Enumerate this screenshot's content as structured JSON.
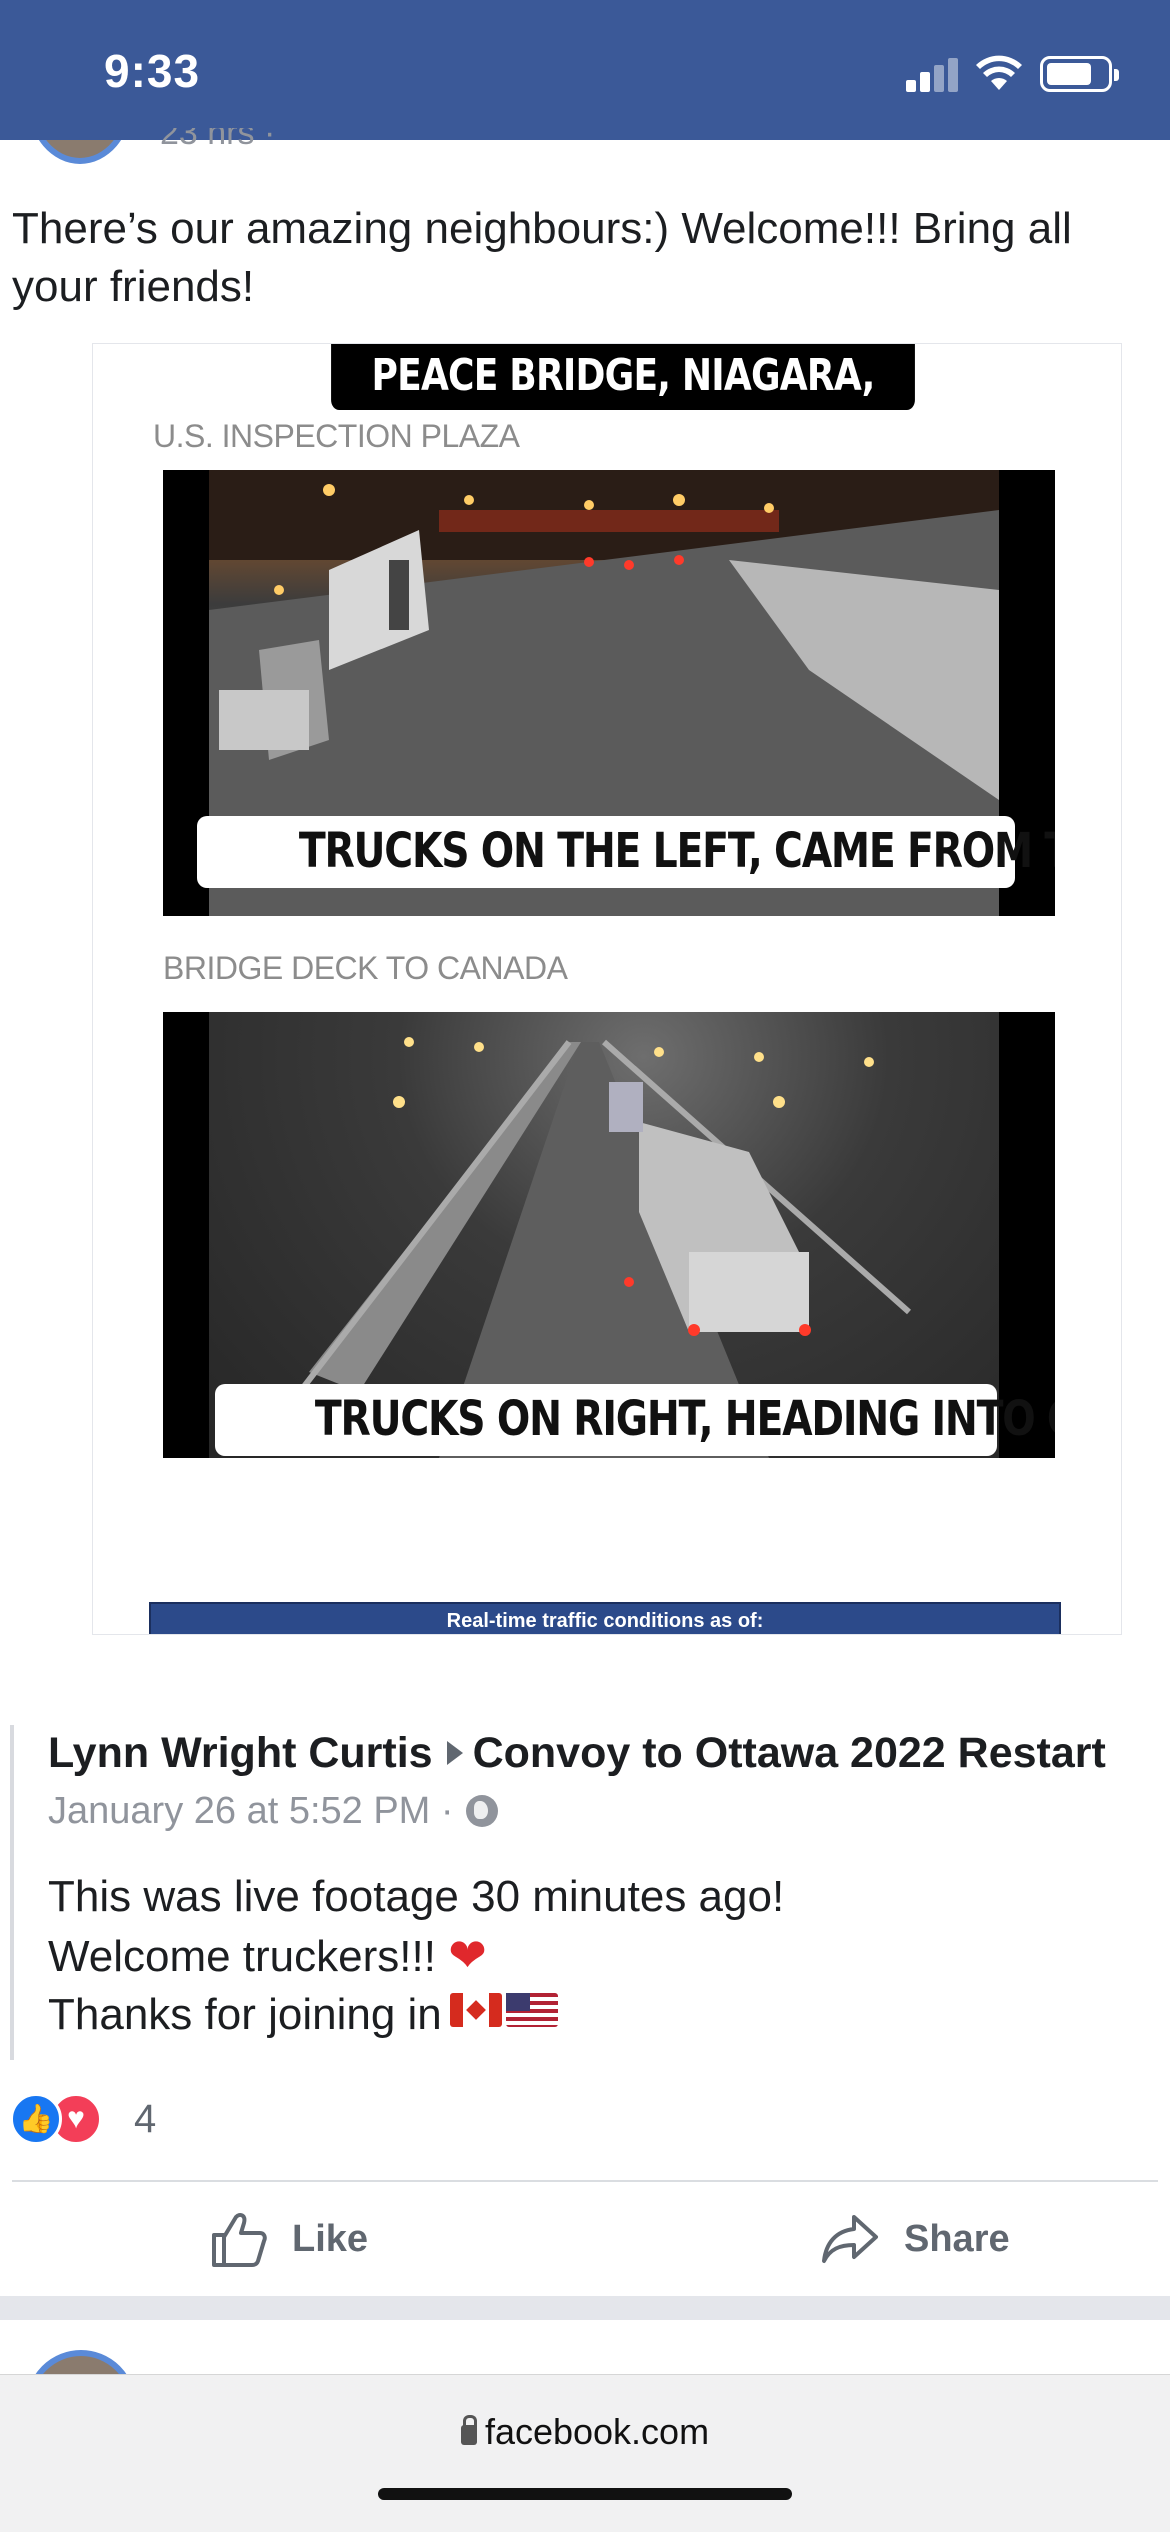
{
  "status_bar": {
    "time": "9:33"
  },
  "post": {
    "text": "There’s our amazing neighbours:) Welcome!!! Bring all your friends!"
  },
  "shared_image": {
    "title": "PEACE BRIDGE, NIAGARA, BUFFALO NY",
    "label_1": "U.S. INSPECTION PLAZA",
    "caption_1": "TRUCKS ON THE LEFT, CAME FROM THE USA",
    "label_2": "BRIDGE DECK TO CANADA",
    "caption_2": "TRUCKS ON RIGHT, HEADING INTO CANADA",
    "banner": "Real-time traffic conditions as of:"
  },
  "shared_post": {
    "author": "Lynn Wright Curtis",
    "group": "Convoy to Ottawa 2022 Restart",
    "time": "January 26 at 5:52 PM ·",
    "line_1": "This was live footage 30 minutes ago!",
    "line_2": "Welcome truckers!!!",
    "line_3": "Thanks for joining in"
  },
  "reactions": {
    "count": "4"
  },
  "actions": {
    "like": "Like",
    "share": "Share"
  },
  "browser": {
    "url": "facebook.com"
  },
  "colors": {
    "status_bar": "#3b5998",
    "like_reaction": "#1877f2",
    "love_reaction": "#f33e58"
  }
}
